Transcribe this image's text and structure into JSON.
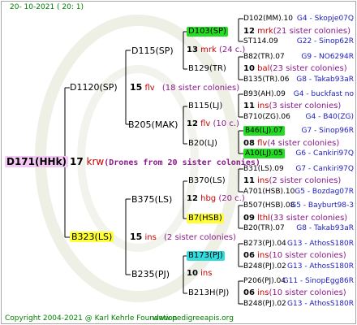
{
  "header": {
    "date": "20-  10-2021  (  20:  1)"
  },
  "footer": {
    "copyright": "Copyright 2004-2021 @ Karl Kehrle Foundation",
    "website": "www.pedigreeapis.org"
  },
  "root": {
    "id": "D171(HHk)",
    "count": "17",
    "race": "krw",
    "note": "(Drones from 20 sister colonies)"
  },
  "gen1": [
    {
      "id": "D1120(SP)",
      "count": "15",
      "race": "flv",
      "note": "(18 sister colonies)"
    },
    {
      "id": "B323(LS)",
      "count": "15",
      "race": "ins",
      "note": "(2 sister colonies)"
    }
  ],
  "gen2": [
    {
      "id": "D115(SP)",
      "count": "13",
      "race": "mrk",
      "note": "(24 c.)"
    },
    {
      "id": "B205(MAK)",
      "count": "12",
      "race": "flv",
      "note": "(10 c.)"
    },
    {
      "id": "B375(LS)",
      "count": "12",
      "race": "hbg",
      "note": "(20 c.)"
    },
    {
      "id": "B235(PJ)",
      "count": "10",
      "race": "ins",
      "note": ""
    }
  ],
  "gen3": [
    {
      "id": "D103(SP)",
      "count": "12",
      "race": "mrk",
      "note": "(21 sister colonies)"
    },
    {
      "id": "B129(TR)",
      "count": "10",
      "race": "bal",
      "note": "(23 sister colonies)"
    },
    {
      "id": "B115(LJ)",
      "count": "11",
      "race": "ins",
      "note": "(3 sister colonies)"
    },
    {
      "id": "B20(LJ)",
      "count": "08",
      "race": "flv",
      "note": "(4 sister colonies)"
    },
    {
      "id": "B370(LS)",
      "count": "11",
      "race": "ins",
      "note": "(2 sister colonies)"
    },
    {
      "id": "B7(HSB)",
      "count": "09",
      "race": "lthl",
      "note": "(33 sister colonies)"
    },
    {
      "id": "B173(PJ)",
      "count": "06",
      "race": "ins",
      "note": "(10 sister colonies)"
    },
    {
      "id": "B213H(PJ)",
      "count": "06",
      "race": "ins",
      "note": "(10 sister colonies)"
    }
  ],
  "gen4": [
    {
      "id": "D102(MM).10",
      "origin": "G4 - Skopje07Q"
    },
    {
      "id": "ST114.09",
      "origin": "G22 - Sinop62R"
    },
    {
      "id": "B82(TR).07",
      "origin": "G9 - NO6294R"
    },
    {
      "id": "B135(TR).06",
      "origin": "G8 - Takab93aR"
    },
    {
      "id": "B93(AH).09",
      "origin": "G4 - buckfast no"
    },
    {
      "id": "B710(ZG).06",
      "origin": "G4 - B40(ZG)"
    },
    {
      "id": "B46(LJ).07",
      "origin": "G7 - Sinop96R"
    },
    {
      "id": "A10(LJ).05",
      "origin": "G6 - Cankiri97Q"
    },
    {
      "id": "B31(LS).09",
      "origin": "G7 - Cankiri97Q"
    },
    {
      "id": "A701(HSB).10",
      "origin": "G5 - Bozdag07R"
    },
    {
      "id": "B507(HSB).08",
      "origin": "G5 - Bayburt98-3"
    },
    {
      "id": "B20(TR).07",
      "origin": "G8 - Takab93aR"
    },
    {
      "id": "B273(PJ).04",
      "origin": "G13 - AthosS180R"
    },
    {
      "id": "B248(PJ).02",
      "origin": "G13 - AthosS180R"
    },
    {
      "id": "P206(PJ).04",
      "origin": "G11 - SinopEgg86R"
    },
    {
      "id": "B248(PJ).02",
      "origin": "G13 - AthosS180R"
    }
  ],
  "colors": {
    "count": "#000000",
    "race": "#cc0000",
    "note": "#8a1a8a",
    "gen4_origin": "#2020c0",
    "highlight_green": "#22dd22",
    "highlight_yellow": "#ffff33",
    "highlight_cyan": "#33dddd",
    "highlight_pink": "#f4c8f4",
    "footer": "#008000"
  }
}
